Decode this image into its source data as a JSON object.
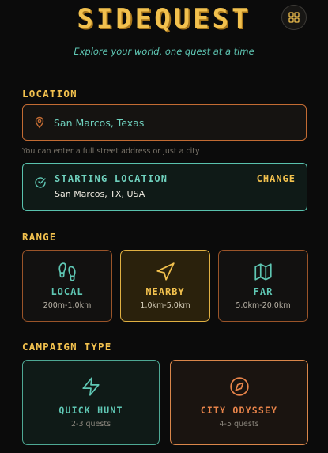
{
  "app": {
    "title": "SIDEQUEST",
    "tagline": "Explore your world, one quest at a time"
  },
  "location": {
    "section_label": "LOCATION",
    "input_value": "San Marcos, Texas",
    "helper_text": "You can enter a full street address or just a city",
    "starting": {
      "title": "STARTING LOCATION",
      "value": "San Marcos, TX, USA",
      "change_label": "CHANGE"
    }
  },
  "range": {
    "section_label": "RANGE",
    "selected": "nearby",
    "options": [
      {
        "id": "local",
        "label": "LOCAL",
        "distance": "200m-1.0km",
        "icon": "footprints-icon"
      },
      {
        "id": "nearby",
        "label": "NEARBY",
        "distance": "1.0km-5.0km",
        "icon": "navigation-icon"
      },
      {
        "id": "far",
        "label": "FAR",
        "distance": "5.0km-20.0km",
        "icon": "map-icon"
      }
    ]
  },
  "campaign": {
    "section_label": "CAMPAIGN TYPE",
    "options": [
      {
        "id": "quick-hunt",
        "label": "QUICK HUNT",
        "count": "2-3 quests",
        "icon": "zap-icon"
      },
      {
        "id": "city-odyssey",
        "label": "CITY ODYSSEY",
        "count": "4-5 quests",
        "icon": "compass-icon"
      }
    ]
  },
  "colors": {
    "gold": "#f2c14e",
    "teal": "#5fc7b4",
    "orange": "#c26b33",
    "background": "#0b0b0b"
  }
}
